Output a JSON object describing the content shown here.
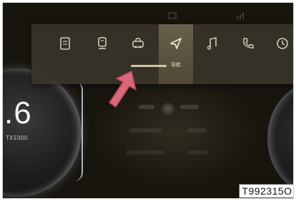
{
  "cluster": {
    "speed_value": ".6",
    "sub_label": "TX1000"
  },
  "menu": {
    "items": [
      {
        "id": "phone-book",
        "label": "",
        "icon": "document-icon"
      },
      {
        "id": "seat",
        "label": "",
        "icon": "seat-icon"
      },
      {
        "id": "vehicle",
        "label": "",
        "icon": "car-icon"
      },
      {
        "id": "navigation",
        "label": "导航",
        "icon": "navigation-arrow-icon",
        "active": true
      },
      {
        "id": "media",
        "label": "",
        "icon": "music-note-icon"
      },
      {
        "id": "phone",
        "label": "",
        "icon": "phone-icon"
      },
      {
        "id": "recent",
        "label": "",
        "icon": "history-icon"
      }
    ]
  },
  "annotation": {
    "arrow_color": "#d9677a",
    "code": "T992315O"
  },
  "colors": {
    "background": "#18150f",
    "menu_bar": "#3a3428",
    "active_item": "#6a604a"
  }
}
